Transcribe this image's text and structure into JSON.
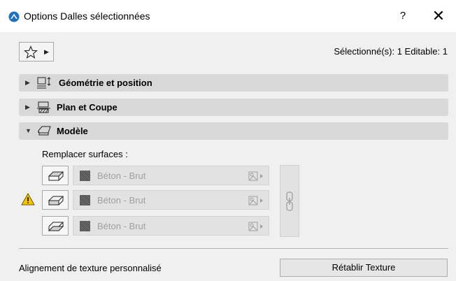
{
  "window": {
    "title": "Options Dalles sélectionnées",
    "help_label": "?",
    "close_label": "✕",
    "app_icon": "archicad-logo-icon"
  },
  "toolbar": {
    "favorites_icon": "star-icon",
    "selection_info": "Sélectionné(s): 1 Editable: 1"
  },
  "panels": [
    {
      "label": "Géométrie et position",
      "expanded": false,
      "icon": "geometry-position-icon"
    },
    {
      "label": "Plan et Coupe",
      "expanded": false,
      "icon": "plan-section-icon"
    },
    {
      "label": "Modèle",
      "expanded": true,
      "icon": "model-icon"
    }
  ],
  "model": {
    "override_label": "Remplacer surfaces :",
    "surfaces": [
      {
        "face": "top-face-icon",
        "material": "Béton - Brut"
      },
      {
        "face": "edge-face-icon",
        "material": "Béton - Brut"
      },
      {
        "face": "bottom-face-icon",
        "material": "Béton - Brut"
      }
    ],
    "warning_icon": "warning-icon",
    "link_icon": "chain-link-icon"
  },
  "footer": {
    "texture_alignment_label": "Alignement de texture personnalisé",
    "reset_texture_label": "Rétablir Texture"
  },
  "colors": {
    "header_bg": "#d8d8d8",
    "dialog_bg": "#f0f0f0",
    "disabled_text": "#a0a0a0",
    "warning": "#f5c400"
  }
}
